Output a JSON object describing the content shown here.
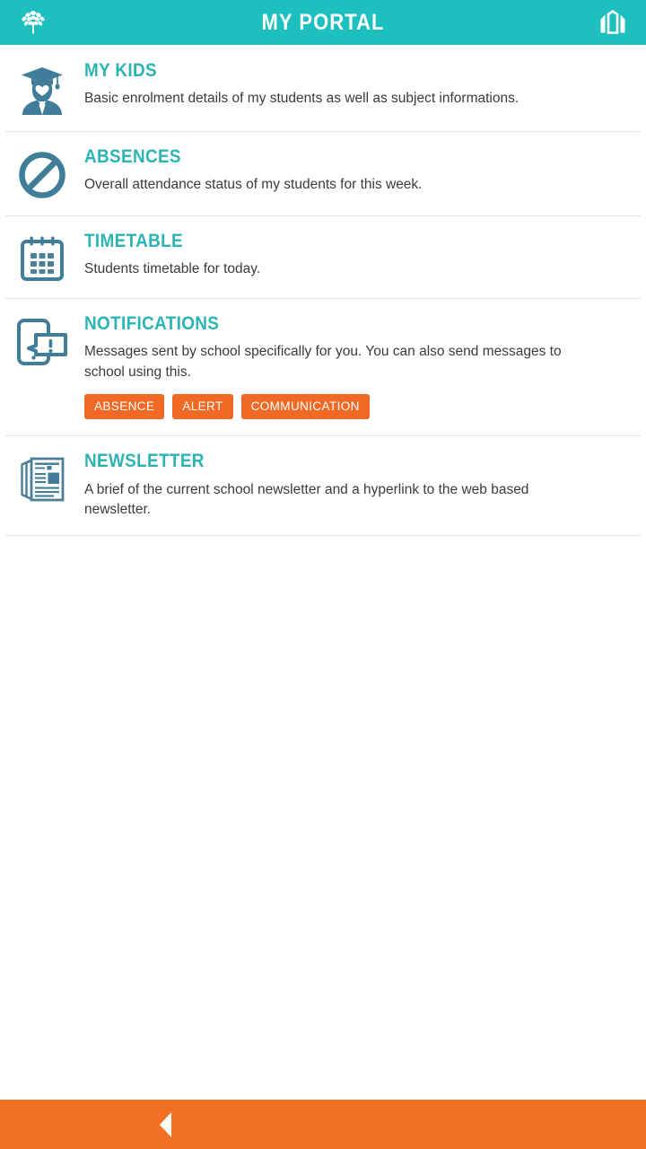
{
  "header": {
    "title": "MY PORTAL",
    "logo_icon": "tree-icon",
    "right_icon": "school-building-icon",
    "background_color": "#1ebfbf"
  },
  "theme": {
    "teal": "#2cb4b4",
    "orange": "#f06a25",
    "icon_slate": "#3f7d99",
    "text": "#3b3b3b",
    "divider": "#e3e3e3"
  },
  "menu": {
    "items": [
      {
        "icon": "graduate-student-icon",
        "title": "MY KIDS",
        "description": "Basic enrolment details of my students as well as subject informations."
      },
      {
        "icon": "no-entry-icon",
        "title": "ABSENCES",
        "description": "Overall attendance status of my students for this week."
      },
      {
        "icon": "calendar-icon",
        "title": "TIMETABLE",
        "description": "Students timetable for today."
      },
      {
        "icon": "phone-message-alert-icon",
        "title": "NOTIFICATIONS",
        "description": "Messages sent by school specifically for you. You can also send messages to school using this.",
        "tags": [
          "ABSENCE",
          "ALERT",
          "COMMUNICATION"
        ]
      },
      {
        "icon": "newspaper-icon",
        "title": "NEWSLETTER",
        "description": "A brief of the current school newsletter and a hyperlink to the web based newsletter."
      }
    ]
  },
  "bottom_bar": {
    "back_icon": "back-triangle-icon",
    "background_color": "#f07024"
  }
}
